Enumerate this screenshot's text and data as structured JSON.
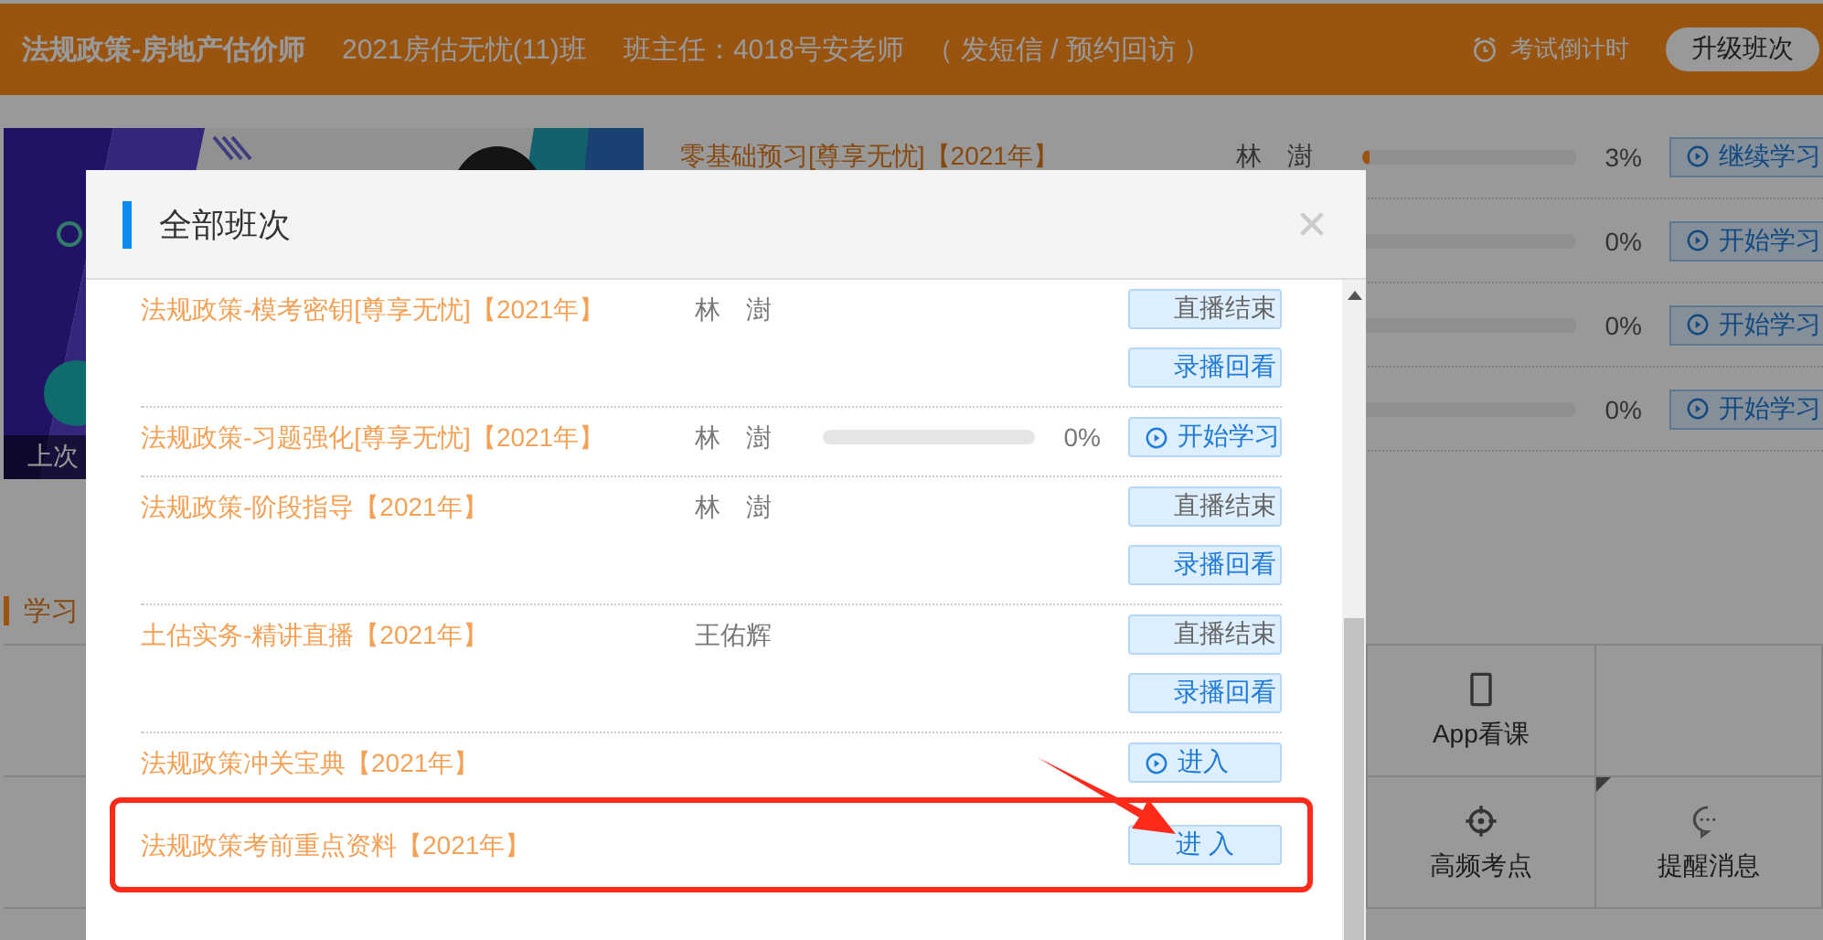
{
  "header": {
    "course": "法规政策-房地产估价师",
    "class_name": "2021房估无忧(11)班",
    "teacher": "班主任：4018号安老师",
    "contact": "（ 发短信 / 预约回访 ）",
    "countdown": "考试倒计时",
    "upgrade_button": "升级班次"
  },
  "banner": {
    "kind": "picture",
    "caption": "上次"
  },
  "courses": [
    {
      "title": "零基础预习[尊享无忧]【2021年】",
      "teacher": "林　澍",
      "level": 0.03,
      "reading": "3%",
      "action": "继续学习"
    },
    {
      "reading": "0%",
      "action": "开始学习"
    },
    {
      "reading": "0%",
      "action": "开始学习"
    },
    {
      "reading": "0%",
      "action": "开始学习"
    }
  ],
  "section_title": "学习",
  "tiles": [
    {
      "label": "App看课",
      "kind": "phone",
      "flagged": false
    },
    {
      "label": "高频考点",
      "kind": "target",
      "flagged": false
    },
    {
      "label": "提醒消息",
      "kind": "chat",
      "flagged": true
    }
  ],
  "modal": {
    "title": "全部班次",
    "rows": [
      {
        "title": "法规政策-模考密钥[尊享无忧]【2021年】",
        "teacher": "林　澍",
        "highlighted": false,
        "actions": [
          {
            "kind": "status",
            "label": "直播结束"
          },
          {
            "kind": "replay",
            "label": "录播回看"
          }
        ]
      },
      {
        "title": "法规政策-习题强化[尊享无忧]【2021年】",
        "teacher": "林　澍",
        "reading": "0%",
        "highlighted": false,
        "actions": [
          {
            "kind": "play",
            "label": "开始学习"
          }
        ]
      },
      {
        "title": "法规政策-阶段指导【2021年】",
        "teacher": "林　澍",
        "highlighted": false,
        "actions": [
          {
            "kind": "status",
            "label": "直播结束"
          },
          {
            "kind": "replay",
            "label": "录播回看"
          }
        ]
      },
      {
        "title": "土估实务-精讲直播【2021年】",
        "teacher": "王佑辉",
        "highlighted": false,
        "actions": [
          {
            "kind": "status",
            "label": "直播结束"
          },
          {
            "kind": "replay",
            "label": "录播回看"
          }
        ]
      },
      {
        "title": "法规政策冲关宝典【2021年】",
        "highlighted": false,
        "actions": [
          {
            "kind": "play",
            "label": "进入"
          }
        ]
      },
      {
        "title": "法规政策考前重点资料【2021年】",
        "highlighted": true,
        "actions": [
          {
            "kind": "plain",
            "label": "进 入"
          }
        ]
      }
    ]
  }
}
